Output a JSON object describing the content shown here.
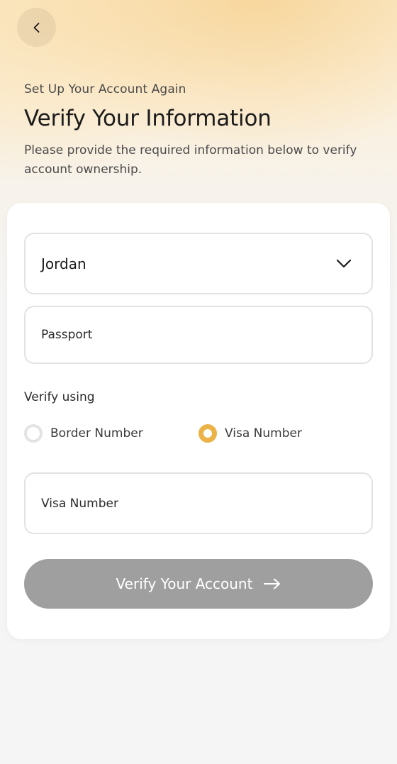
{
  "header": {
    "back_icon": "chevron-left-icon",
    "subtitle": "Set Up Your Account Again",
    "title": "Verify Your Information",
    "description": "Please provide the required information below to verify account ownership."
  },
  "form": {
    "country": {
      "value": "Jordan",
      "icon": "chevron-down-icon"
    },
    "document_type": {
      "placeholder": "Passport"
    },
    "verify_using_label": "Verify using",
    "options": [
      {
        "label": "Border Number",
        "checked": false
      },
      {
        "label": "Visa Number",
        "checked": true
      }
    ],
    "visa_number": {
      "placeholder": "Visa Number"
    },
    "submit_label": "Verify Your Account",
    "submit_icon": "arrow-right-icon"
  },
  "colors": {
    "accent": "#ebb248",
    "button_disabled": "#9f9f9f"
  }
}
